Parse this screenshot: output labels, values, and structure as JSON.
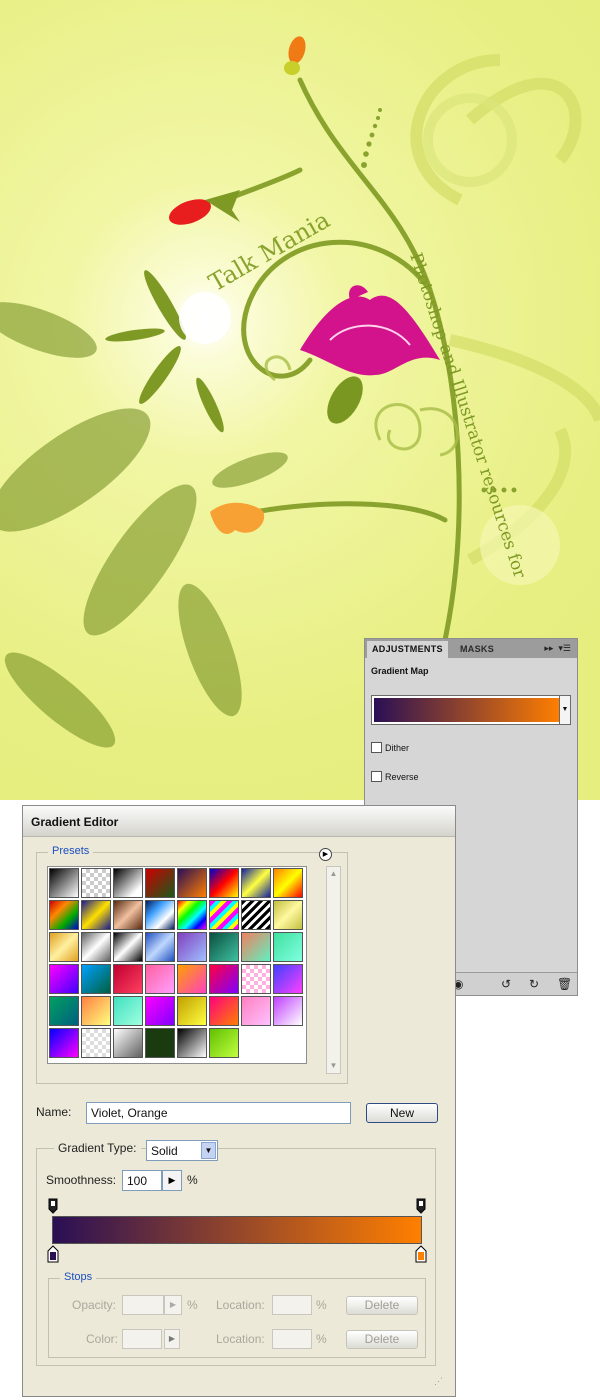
{
  "artwork": {
    "brand": "Talk Mania",
    "tagline": "Photoshop and Illustrator resources for"
  },
  "adjustments": {
    "tab_active": "ADJUSTMENTS",
    "tab_inactive": "MASKS",
    "panel_title": "Gradient Map",
    "gradient_start": "#2a0f55",
    "gradient_end": "#ff7f00",
    "dither_label": "Dither",
    "dither_checked": false,
    "reverse_label": "Reverse",
    "reverse_checked": false
  },
  "gradient_editor": {
    "title": "Gradient Editor",
    "presets_label": "Presets",
    "name_label": "Name:",
    "name_value": "Violet, Orange",
    "new_button": "New",
    "gradient_type_label": "Gradient Type:",
    "gradient_type_value": "Solid",
    "smoothness_label": "Smoothness:",
    "smoothness_value": "100",
    "smoothness_unit": "%",
    "stops_label": "Stops",
    "opacity_label": "Opacity:",
    "color_label": "Color:",
    "location_label": "Location:",
    "percent": "%",
    "delete_button": "Delete",
    "start_color": "#2a0f55",
    "end_color": "#ff7f00"
  }
}
